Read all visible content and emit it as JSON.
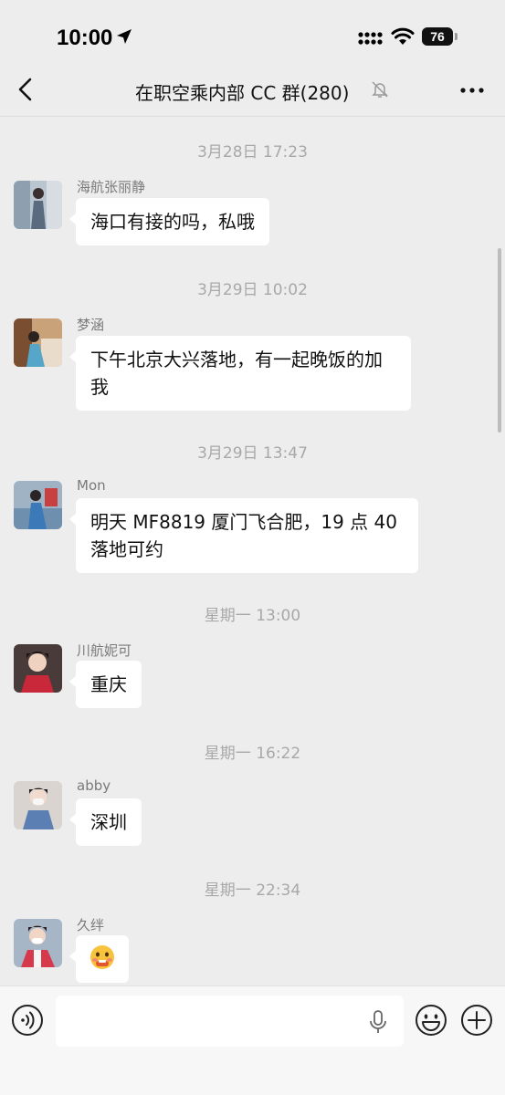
{
  "status_bar": {
    "time": "10:00",
    "battery": "76"
  },
  "nav": {
    "title": "在职空乘内部 CC 群(280)"
  },
  "messages": [
    {
      "time": "3月28日 17:23",
      "sender": "海航张丽静",
      "text": "海口有接的吗，私哦",
      "avatar": "avatar-1"
    },
    {
      "time": "3月29日 10:02",
      "sender": "梦涵",
      "text": "下午北京大兴落地，有一起晚饭的加我",
      "avatar": "avatar-2"
    },
    {
      "time": "3月29日 13:47",
      "sender": "Mon",
      "text": "明天 MF8819 厦门飞合肥，19 点 40 落地可约",
      "avatar": "avatar-3"
    },
    {
      "time": "星期一 13:00",
      "sender": "川航妮可",
      "text": "重庆",
      "avatar": "avatar-4"
    },
    {
      "time": "星期一 16:22",
      "sender": "abby",
      "text": "深圳",
      "avatar": "avatar-5"
    },
    {
      "time": "星期一 22:34",
      "sender": "久绊",
      "text": "",
      "sticker": "grimace-emoji",
      "avatar": "avatar-6"
    }
  ],
  "input": {
    "placeholder": ""
  },
  "colors": {
    "background": "#ededed",
    "bubble": "#ffffff",
    "timestamp": "#a8a8a8"
  }
}
